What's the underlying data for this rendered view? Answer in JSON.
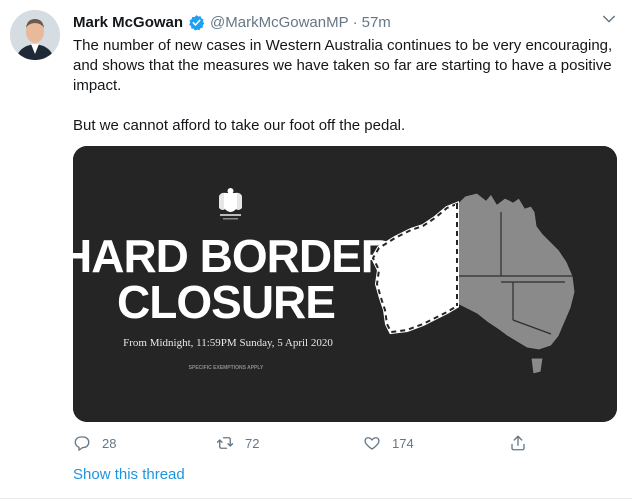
{
  "tweet": {
    "display_name": "Mark McGowan",
    "handle": "@MarkMcGowanMP",
    "separator": "·",
    "time": "57m",
    "paragraphs": [
      "The number of new cases in Western Australia continues to be very encouraging, and shows that the measures we have taken so far are starting to have a positive impact.",
      "But we cannot afford to take our foot off the pedal."
    ]
  },
  "media": {
    "headline_line1": "HARD BORDER",
    "headline_line2": "CLOSURE",
    "subline": "From Midnight, 11:59PM Sunday, 5 April 2020",
    "fineprint": "SPECIFIC EXEMPTIONS APPLY",
    "map_fill_wa": "#ffffff",
    "map_fill_rest": "#8a8a8a"
  },
  "actions": {
    "replies": "28",
    "retweets": "72",
    "likes": "174"
  },
  "show_thread": "Show this thread",
  "colors": {
    "link_blue": "#1b95e0",
    "verified_blue": "#1da1f2",
    "muted": "#657786"
  }
}
